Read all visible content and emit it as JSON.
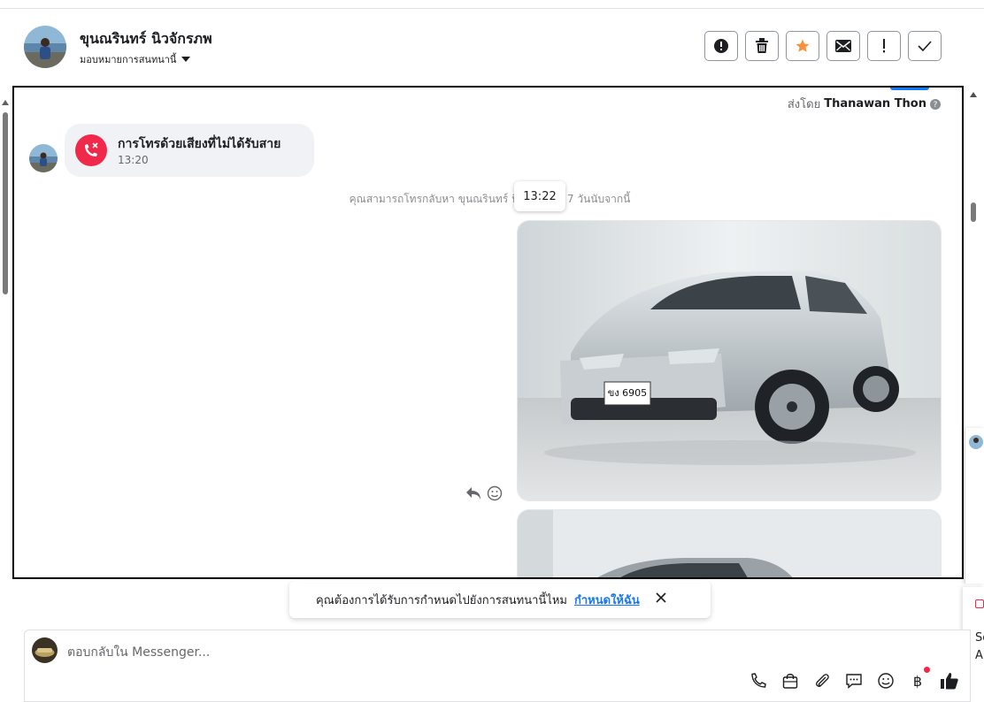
{
  "header": {
    "contact_name": "ขุนณรินทร์ นิวจักรภพ",
    "assign_label": "มอบหมายการสนทนานี้",
    "actions": [
      {
        "name": "spam-button",
        "glyph": "!"
      },
      {
        "name": "delete-button",
        "glyph": "trash"
      },
      {
        "name": "star-button",
        "glyph": "star"
      },
      {
        "name": "mark-unread-button",
        "glyph": "mail"
      },
      {
        "name": "follow-up-button",
        "glyph": "!"
      },
      {
        "name": "done-button",
        "glyph": "check"
      }
    ]
  },
  "thread": {
    "sent_by_prefix": "ส่งโดย",
    "sent_by_name": "Thanawan Thon",
    "missed_call_title": "การโทรด้วยเสียงที่ไม่ได้รับสาย",
    "missed_call_time": "13:20",
    "callback_note": "คุณสามารถโทรกลับหา ขุนณรินทร์ นิวจัก... อีก 7 วันนับจากนี้",
    "hover_time": "13:22",
    "plate_text": "ขง 6905"
  },
  "assign_prompt": {
    "question": "คุณต้องการได้รับการกำหนดไปยังการสนทนานี้ไหม",
    "link": "กำหนดให้ฉัน"
  },
  "composer": {
    "placeholder": "ตอบกลับใน Messenger..."
  },
  "side_peek": {
    "text_1": "Se",
    "text_2": "A"
  },
  "colors": {
    "accent": "#1877f2",
    "missed_call": "#f02849",
    "star": "#f7923b"
  }
}
